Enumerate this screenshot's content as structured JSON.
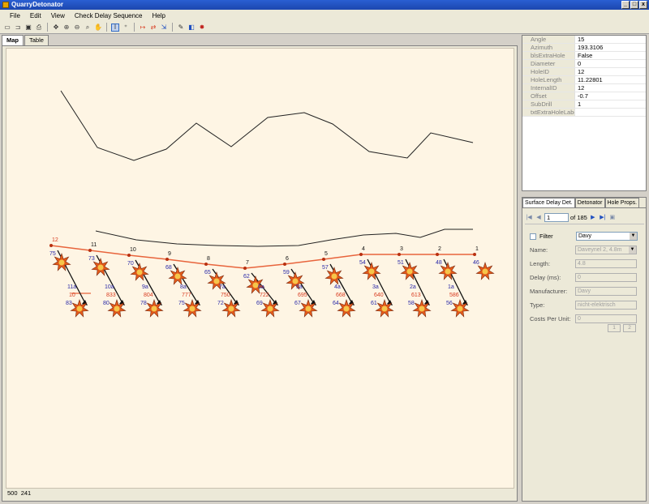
{
  "window": {
    "title": "QuarryDetonator",
    "buttons": [
      "_",
      "□",
      "x"
    ]
  },
  "menu": [
    "File",
    "Edit",
    "View",
    "Check Delay Sequence",
    "Help"
  ],
  "toolbar_icons": [
    "new-icon",
    "open-icon",
    "save-icon",
    "print-icon",
    "sep",
    "zoom-extent-icon",
    "zoom-in-icon",
    "zoom-out-icon",
    "zoom-window-icon",
    "pan-icon",
    "sep",
    "select-hole-icon",
    "add-hole-icon",
    "sep",
    "connect-icon",
    "reverse-icon",
    "export-icon",
    "sep",
    "measure-icon",
    "fill-icon",
    "detonate-icon"
  ],
  "tabs": [
    "Map",
    "Table"
  ],
  "status": {
    "x": "500",
    "y": "241"
  },
  "properties": [
    {
      "name": "Angle",
      "value": "15"
    },
    {
      "name": "Azimuth",
      "value": "193.3106"
    },
    {
      "name": "blsExtraHole",
      "value": "False"
    },
    {
      "name": "Diameter",
      "value": "0"
    },
    {
      "name": "HoleID",
      "value": "12"
    },
    {
      "name": "HoleLength",
      "value": "11.22801"
    },
    {
      "name": "InternalID",
      "value": "12"
    },
    {
      "name": "Offset",
      "value": "-0.7"
    },
    {
      "name": "SubDrill",
      "value": "1"
    },
    {
      "name": "txtExtraHoleLabel",
      "value": ""
    }
  ],
  "right_tabs": [
    "Surface Delay Det.",
    "Detonator",
    "Hole Props."
  ],
  "navigator": {
    "current": "1",
    "of_text": "of 185"
  },
  "form": {
    "filter_label": "Filter",
    "filter_value": "Davy",
    "name_label": "Name:",
    "name_value": "Daveynel 2, 4.8m",
    "length_label": "Length:",
    "length_value": "4.8",
    "delay_label": "Delay (ms):",
    "delay_value": "0",
    "manufacturer_label": "Manufacturer:",
    "manufacturer_value": "Davy",
    "type_label": "Type:",
    "type_value": "nicht-elektrisch",
    "cost_label": "Costs Per Unit:",
    "cost_value": "0",
    "page_buttons": [
      "1",
      "2"
    ]
  },
  "map": {
    "top_row": [
      {
        "label": "12",
        "sub": "75"
      },
      {
        "label": "11",
        "sub": "73"
      },
      {
        "label": "10",
        "sub": "70"
      },
      {
        "label": "9",
        "sub": "68"
      },
      {
        "label": "8",
        "sub": "65"
      },
      {
        "label": "7",
        "sub": "62"
      },
      {
        "label": "6",
        "sub": "59"
      },
      {
        "label": "5",
        "sub": "57"
      },
      {
        "label": "4",
        "sub": "54"
      },
      {
        "label": "3",
        "sub": "51"
      },
      {
        "label": "2",
        "sub": "48"
      },
      {
        "label": "1",
        "sub": "46"
      }
    ],
    "bottom_row": [
      {
        "label": "11a",
        "sub": "83",
        "delay": "10"
      },
      {
        "label": "10a",
        "sub": "80",
        "delay": "833"
      },
      {
        "label": "9a",
        "sub": "78",
        "delay": "804"
      },
      {
        "label": "8a",
        "sub": "75",
        "delay": "777"
      },
      {
        "label": "7a",
        "sub": "72",
        "delay": "750"
      },
      {
        "label": "6a",
        "sub": "69",
        "delay": "722"
      },
      {
        "label": "5a",
        "sub": "67",
        "delay": "695"
      },
      {
        "label": "4a",
        "sub": "64",
        "delay": "668"
      },
      {
        "label": "3a",
        "sub": "61",
        "delay": "640"
      },
      {
        "label": "2a",
        "sub": "58",
        "delay": "613"
      },
      {
        "label": "1a",
        "sub": "56",
        "delay": "586"
      }
    ],
    "colors": {
      "trunk": "#e8643c",
      "hole_label": "#2a2aa8",
      "delay": "#d83c20",
      "star_fill": "#e35a1a",
      "star_core": "#f6c54a"
    }
  }
}
